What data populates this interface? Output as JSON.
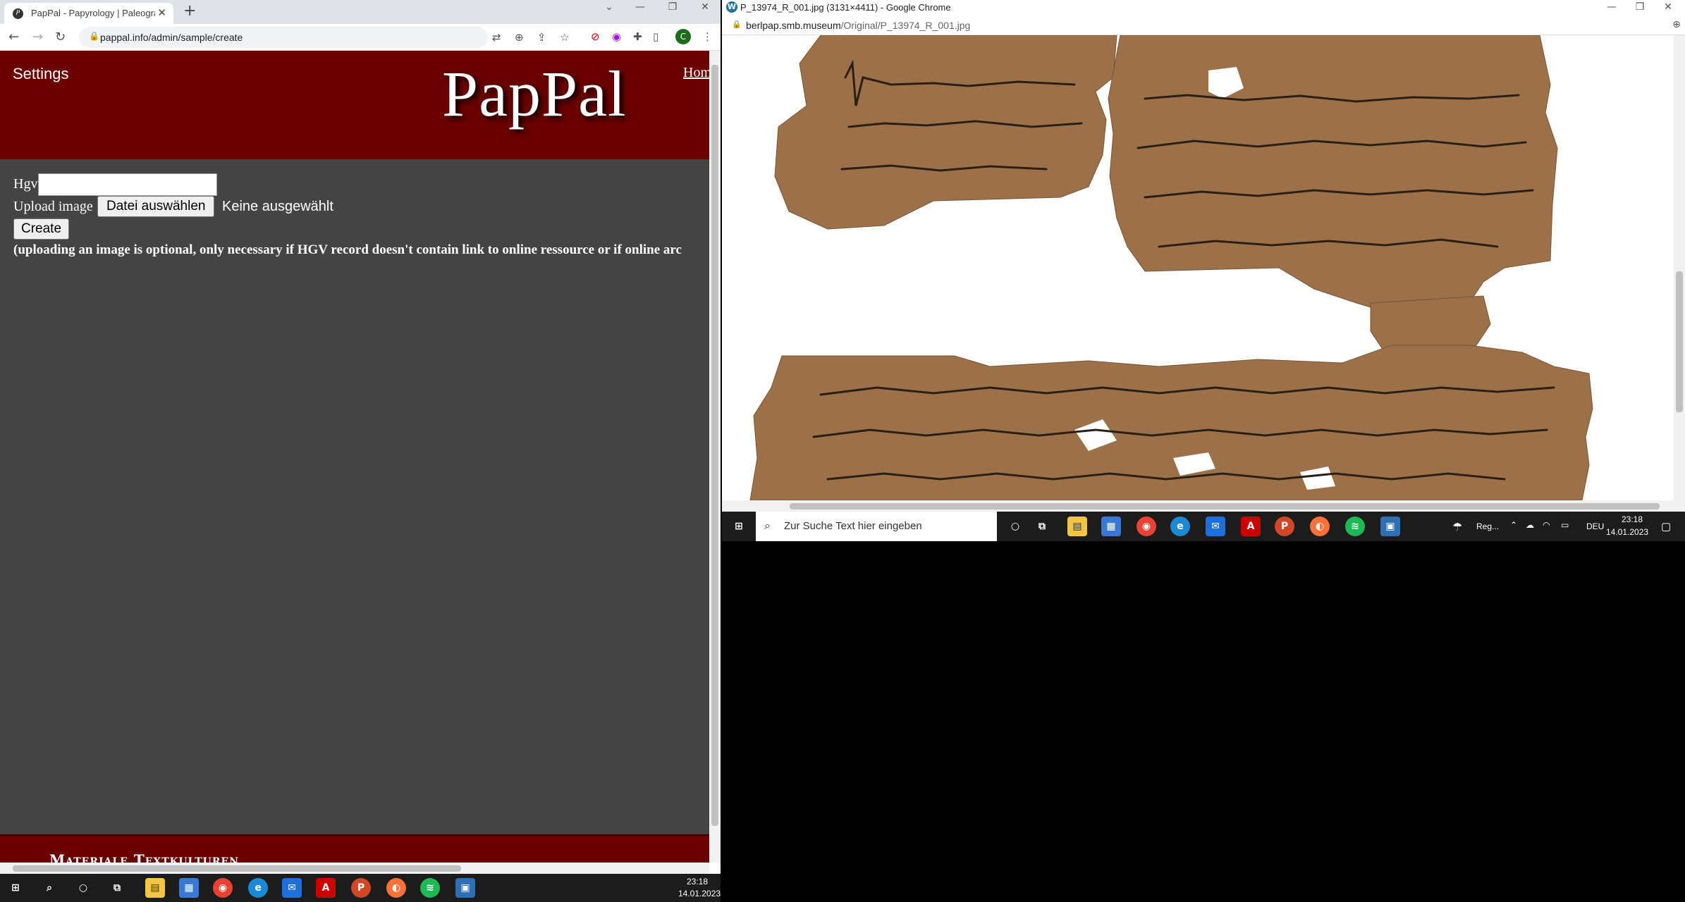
{
  "left_browser": {
    "tab_title": "PapPal - Papyrology | Paleograph",
    "address": "pappal.info/admin/sample/create",
    "profile_initial": "C"
  },
  "page": {
    "settings_link": "Settings",
    "logo": "PapPal",
    "home_link": "Home",
    "hgv_label": "Hgv",
    "hgv_value": "",
    "upload_label": "Upload image",
    "file_button": "Datei auswählen",
    "file_status": "Keine ausgewählt",
    "create_button": "Create",
    "hint": "(uploading an image is optional, only necessary if HGV record doesn't contain link to online ressource or if online arc",
    "footer": "Materiale Textkulturen"
  },
  "right_browser": {
    "window_title": "P_13974_R_001.jpg (3131×4411) - Google Chrome",
    "address_host": "berlpap.smb.museum",
    "address_path": "/Original/P_13974_R_001.jpg"
  },
  "right_taskbar": {
    "search_placeholder": "Zur Suche Text hier eingeben",
    "weather": "Reg...",
    "language": "DEU",
    "time": "23:18",
    "date": "14.01.2023"
  },
  "bottom_taskbar": {
    "time": "23:18",
    "date": "14.01.2023"
  },
  "colors": {
    "header_red": "#6b0000",
    "body_gray": "#444444",
    "papyrus": "#9c7149"
  }
}
